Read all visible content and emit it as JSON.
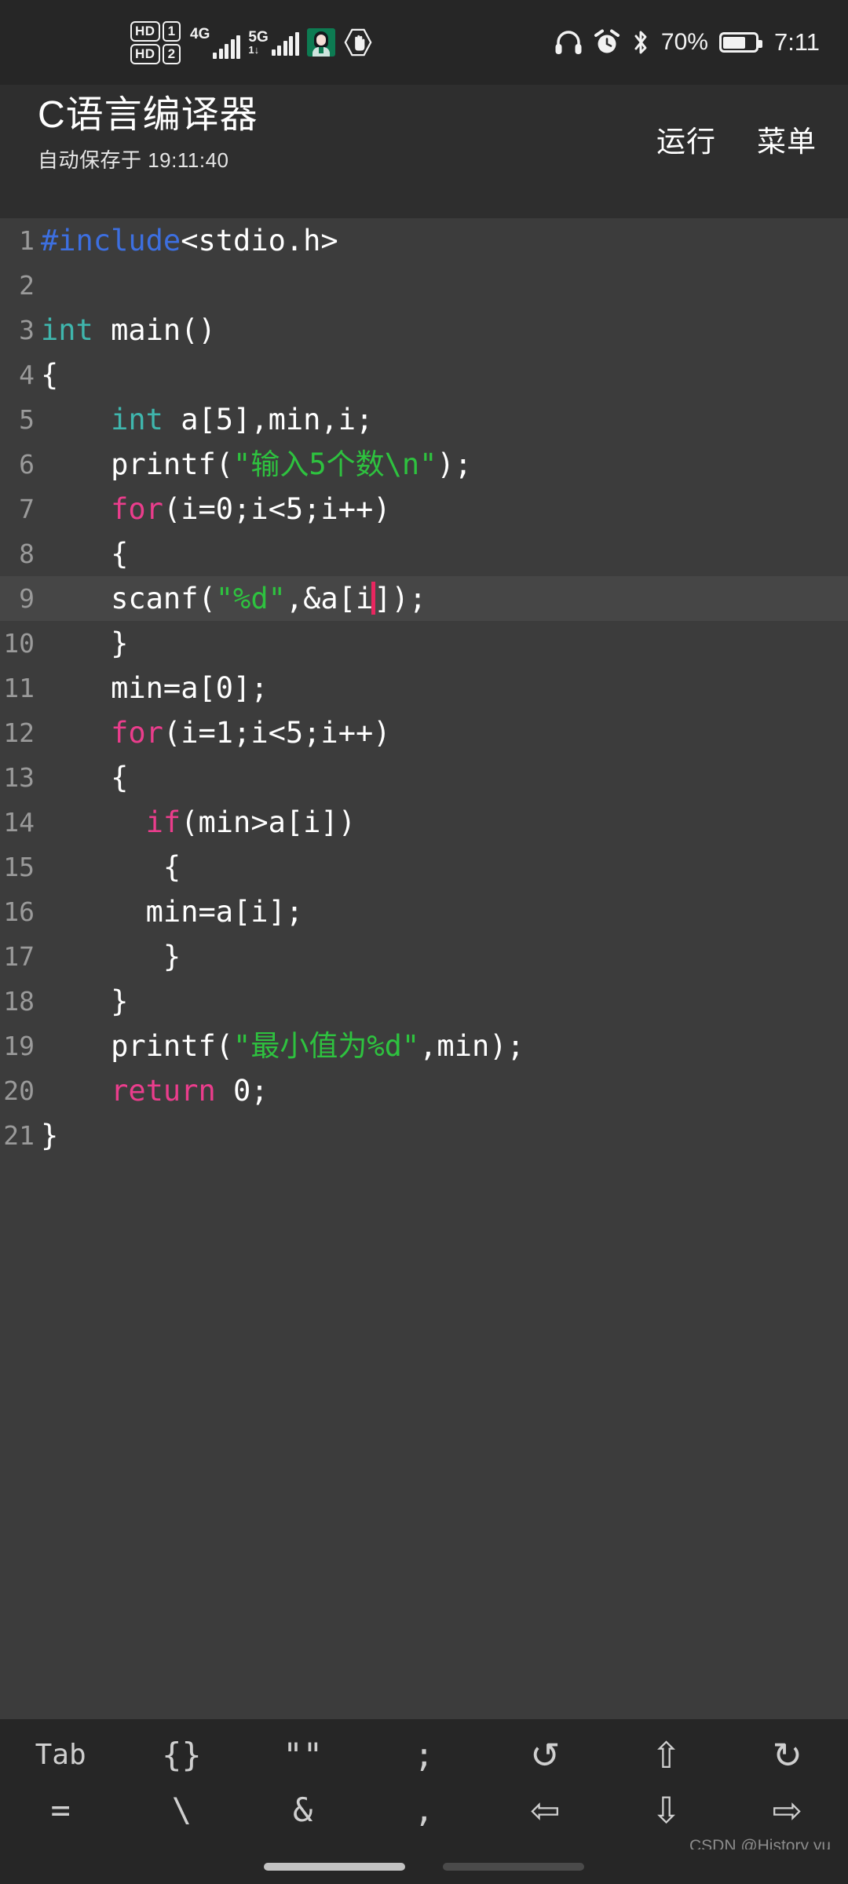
{
  "statusbar": {
    "sim1_hd": "HD",
    "sim1_num": "1",
    "sim2_hd": "HD",
    "sim2_num": "2",
    "net1_label": "4G",
    "net2_label": "5G",
    "net2_data": "1↓",
    "avatar_icon": "person-avatar-icon",
    "block_icon": "hand-stop-icon",
    "headphone_icon": "headphones-icon",
    "alarm_icon": "alarm-clock-icon",
    "bluetooth_icon": "bluetooth-icon",
    "battery_percent": "70%",
    "battery_level": 70,
    "clock": "7:11"
  },
  "appbar": {
    "title": "C语言编译器",
    "subtitle": "自动保存于 19:11:40",
    "run_label": "运行",
    "menu_label": "菜单"
  },
  "editor": {
    "active_line": 9,
    "colors": {
      "background": "#3c3c3c",
      "active_line_bg": "#464646",
      "gutter_text": "#9a9a9a",
      "plain": "#ffffff",
      "preprocessor": "#3d6fe0",
      "type": "#3fb6ad",
      "keyword": "#ea3d8c",
      "string": "#2ec23f",
      "caret": "#e8265f"
    },
    "lines": [
      {
        "n": "1",
        "tokens": [
          {
            "t": "pre",
            "v": "#include"
          },
          {
            "t": "plain",
            "v": "<stdio.h>"
          }
        ]
      },
      {
        "n": "2",
        "tokens": []
      },
      {
        "n": "3",
        "tokens": [
          {
            "t": "type",
            "v": "int"
          },
          {
            "t": "plain",
            "v": " main()"
          }
        ]
      },
      {
        "n": "4",
        "tokens": [
          {
            "t": "plain",
            "v": "{"
          }
        ]
      },
      {
        "n": "5",
        "tokens": [
          {
            "t": "plain",
            "v": "    "
          },
          {
            "t": "type",
            "v": "int"
          },
          {
            "t": "plain",
            "v": " a[5],min,i;"
          }
        ]
      },
      {
        "n": "6",
        "tokens": [
          {
            "t": "plain",
            "v": "    printf("
          },
          {
            "t": "str",
            "v": "\"输入5个数\\n\""
          },
          {
            "t": "plain",
            "v": ");"
          }
        ]
      },
      {
        "n": "7",
        "tokens": [
          {
            "t": "plain",
            "v": "    "
          },
          {
            "t": "kw",
            "v": "for"
          },
          {
            "t": "plain",
            "v": "(i=0;i<5;i++)"
          }
        ]
      },
      {
        "n": "8",
        "tokens": [
          {
            "t": "plain",
            "v": "    {"
          }
        ]
      },
      {
        "n": "9",
        "tokens": [
          {
            "t": "plain",
            "v": "    scanf("
          },
          {
            "t": "str",
            "v": "\"%d\""
          },
          {
            "t": "plain",
            "v": ",&a[i"
          },
          {
            "t": "caret",
            "v": ""
          },
          {
            "t": "plain",
            "v": "]);"
          }
        ]
      },
      {
        "n": "10",
        "tokens": [
          {
            "t": "plain",
            "v": "    }"
          }
        ]
      },
      {
        "n": "11",
        "tokens": [
          {
            "t": "plain",
            "v": "    min=a[0];"
          }
        ]
      },
      {
        "n": "12",
        "tokens": [
          {
            "t": "plain",
            "v": "    "
          },
          {
            "t": "kw",
            "v": "for"
          },
          {
            "t": "plain",
            "v": "(i=1;i<5;i++)"
          }
        ]
      },
      {
        "n": "13",
        "tokens": [
          {
            "t": "plain",
            "v": "    {"
          }
        ]
      },
      {
        "n": "14",
        "tokens": [
          {
            "t": "plain",
            "v": "      "
          },
          {
            "t": "kw",
            "v": "if"
          },
          {
            "t": "plain",
            "v": "(min>a[i])"
          }
        ]
      },
      {
        "n": "15",
        "tokens": [
          {
            "t": "plain",
            "v": "       {"
          }
        ]
      },
      {
        "n": "16",
        "tokens": [
          {
            "t": "plain",
            "v": "      min=a[i];"
          }
        ]
      },
      {
        "n": "17",
        "tokens": [
          {
            "t": "plain",
            "v": "       }"
          }
        ]
      },
      {
        "n": "18",
        "tokens": [
          {
            "t": "plain",
            "v": "    }"
          }
        ]
      },
      {
        "n": "19",
        "tokens": [
          {
            "t": "plain",
            "v": "    printf("
          },
          {
            "t": "str",
            "v": "\"最小值为%d\""
          },
          {
            "t": "plain",
            "v": ",min);"
          }
        ]
      },
      {
        "n": "20",
        "tokens": [
          {
            "t": "plain",
            "v": "    "
          },
          {
            "t": "kw",
            "v": "return"
          },
          {
            "t": "plain",
            "v": " 0;"
          }
        ]
      },
      {
        "n": "21",
        "tokens": [
          {
            "t": "plain",
            "v": "}"
          }
        ]
      }
    ]
  },
  "keybar": {
    "row1": [
      {
        "label": "Tab",
        "name": "key-tab",
        "kind": "text"
      },
      {
        "label": "{}",
        "name": "key-braces",
        "kind": "sym"
      },
      {
        "label": "\"\"",
        "name": "key-quotes",
        "kind": "sym"
      },
      {
        "label": ";",
        "name": "key-semicolon",
        "kind": "sym"
      },
      {
        "label": "↺",
        "name": "key-undo",
        "kind": "arrow"
      },
      {
        "label": "⇧",
        "name": "key-cursor-up",
        "kind": "arrow"
      },
      {
        "label": "↻",
        "name": "key-redo",
        "kind": "arrow"
      }
    ],
    "row2": [
      {
        "label": "=",
        "name": "key-equals",
        "kind": "sym"
      },
      {
        "label": "\\",
        "name": "key-backslash",
        "kind": "sym"
      },
      {
        "label": "&",
        "name": "key-ampersand",
        "kind": "sym"
      },
      {
        "label": ",",
        "name": "key-comma",
        "kind": "sym"
      },
      {
        "label": "⇦",
        "name": "key-cursor-left",
        "kind": "arrow"
      },
      {
        "label": "⇩",
        "name": "key-cursor-down",
        "kind": "arrow"
      },
      {
        "label": "⇨",
        "name": "key-cursor-right",
        "kind": "arrow"
      }
    ]
  },
  "watermark": "CSDN @History yu"
}
